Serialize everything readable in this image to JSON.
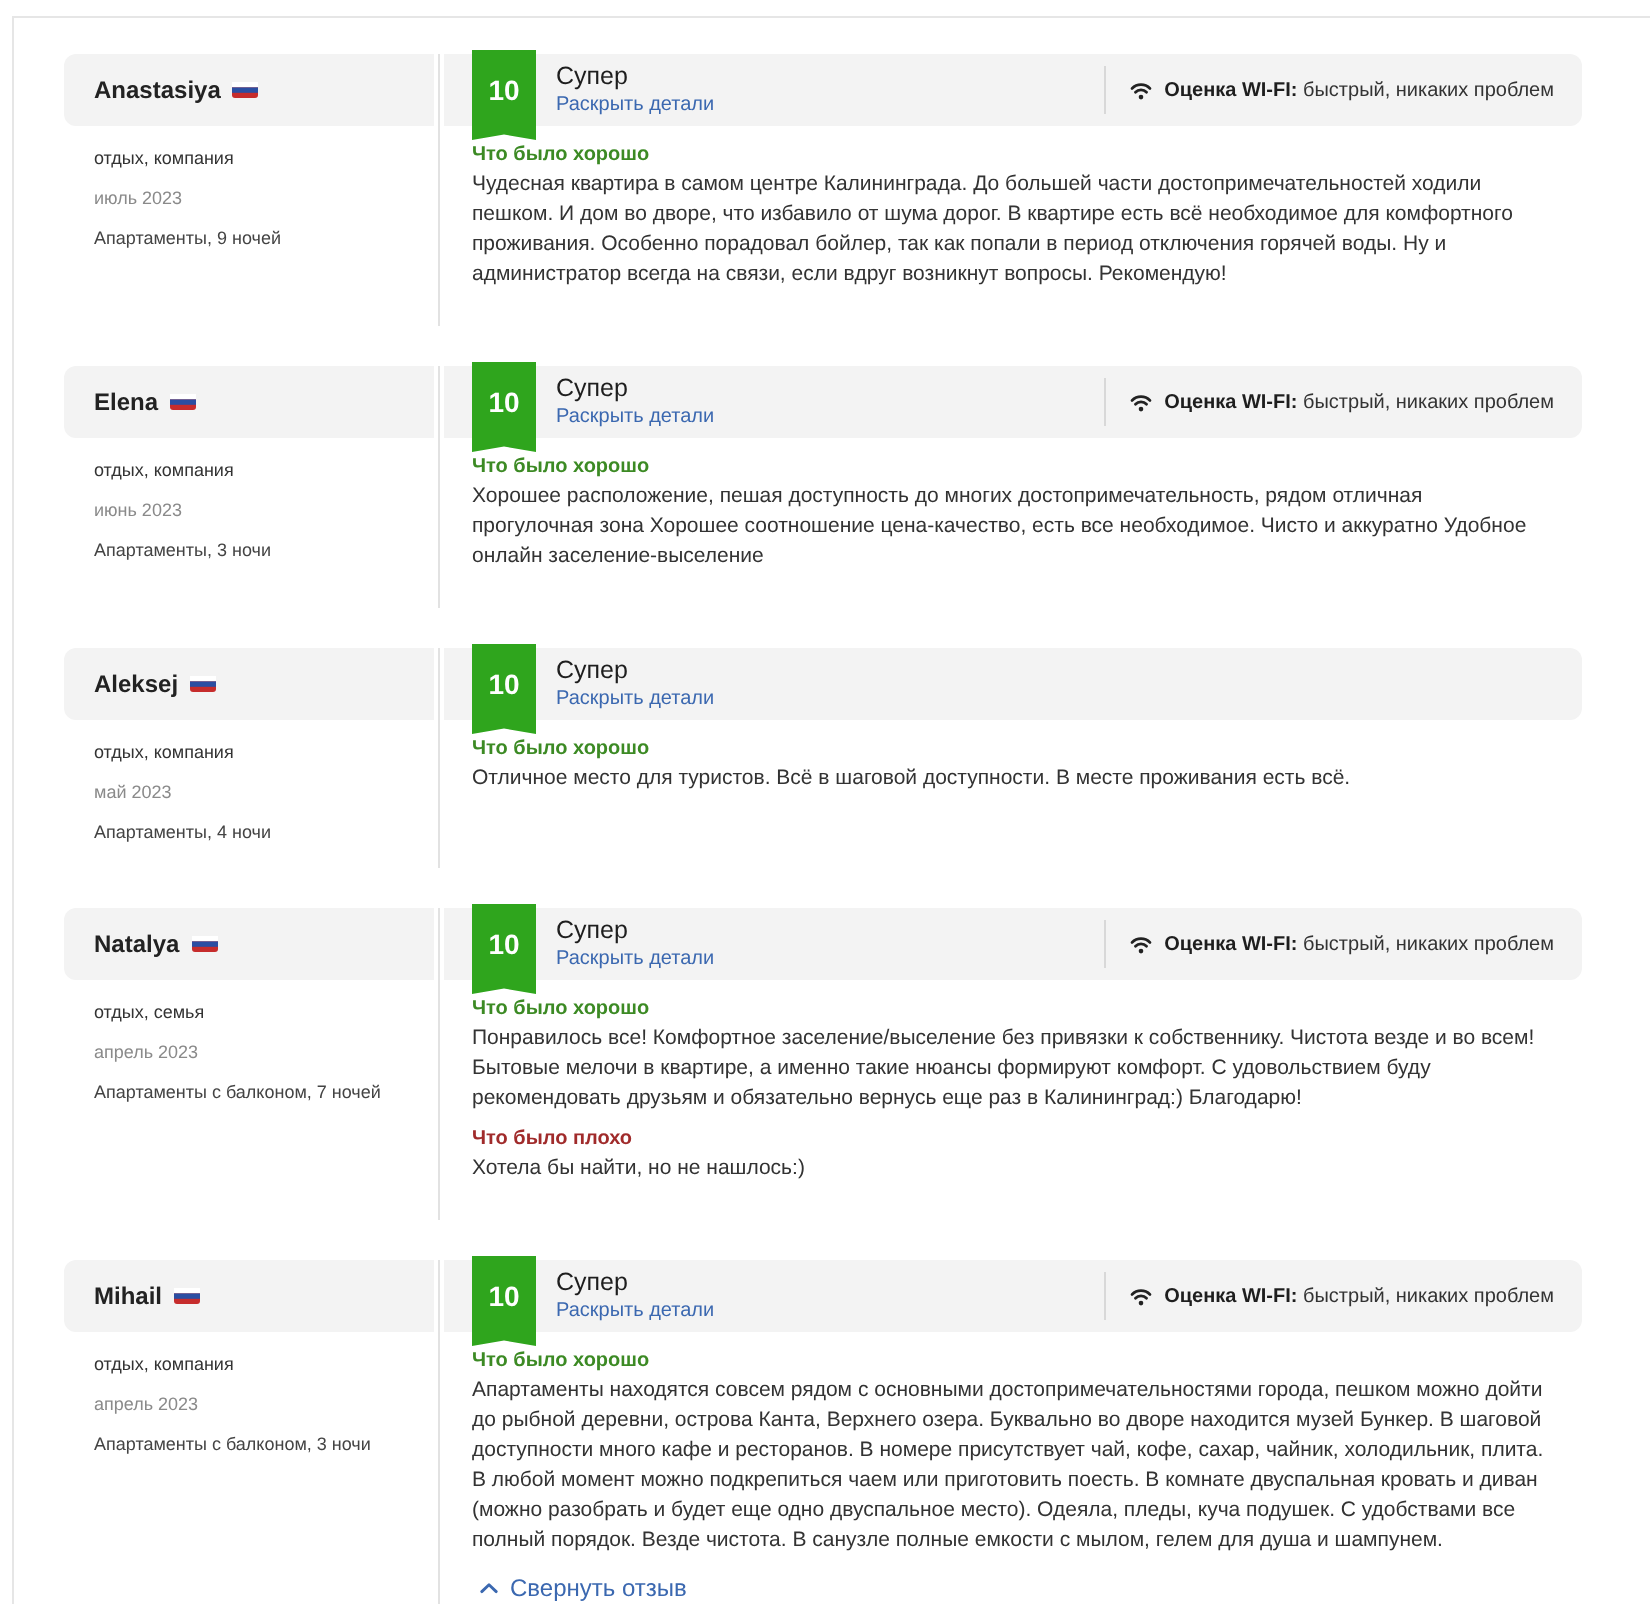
{
  "reviews": [
    {
      "name": "Anastasiya",
      "trip_type": "отдых, компания",
      "date": "июль 2023",
      "stay": "Апартаменты, 9 ночей",
      "score": "10",
      "verdict": "Супер",
      "details_link": "Раскрыть детали",
      "wifi": {
        "label": "Оценка WI-FI:",
        "value": "быстрый, никаких проблем"
      },
      "sections": [
        {
          "kind": "liked",
          "heading": "Что было хорошо",
          "text": "Чудесная квартира в самом центре Калининграда. До большей части достопримечательностей ходили пешком. И дом во дворе, что избавило от шума дорог. В квартире есть всё необходимое для комфортного проживания. Особенно порадовал бойлер, так как попали в период отключения горячей воды. Ну и администратор всегда на связи, если вдруг возникнут вопросы. Рекомендую!"
        }
      ]
    },
    {
      "name": "Elena",
      "trip_type": "отдых, компания",
      "date": "июнь 2023",
      "stay": "Апартаменты, 3 ночи",
      "score": "10",
      "verdict": "Супер",
      "details_link": "Раскрыть детали",
      "wifi": {
        "label": "Оценка WI-FI:",
        "value": "быстрый, никаких проблем"
      },
      "sections": [
        {
          "kind": "liked",
          "heading": "Что было хорошо",
          "text": "Хорошее расположение, пешая доступность до многих достопримечательность, рядом отличная прогулочная зона Хорошее соотношение цена-качество, есть все необходимое. Чисто и аккуратно Удобное онлайн заселение-выселение"
        }
      ]
    },
    {
      "name": "Aleksej",
      "trip_type": "отдых, компания",
      "date": "май 2023",
      "stay": "Апартаменты, 4 ночи",
      "score": "10",
      "verdict": "Супер",
      "details_link": "Раскрыть детали",
      "sections": [
        {
          "kind": "liked",
          "heading": "Что было хорошо",
          "text": "Отличное место для туристов. Всё в шаговой доступности. В месте проживания есть всё."
        }
      ]
    },
    {
      "name": "Natalya",
      "trip_type": "отдых, семья",
      "date": "апрель 2023",
      "stay": "Апартаменты с балконом, 7 ночей",
      "score": "10",
      "verdict": "Супер",
      "details_link": "Раскрыть детали",
      "wifi": {
        "label": "Оценка WI-FI:",
        "value": "быстрый, никаких проблем"
      },
      "sections": [
        {
          "kind": "liked",
          "heading": "Что было хорошо",
          "text": "Понравилось все! Комфортное заселение/выселение без привязки к собственнику. Чистота везде и во всем! Бытовые мелочи в квартире, а именно такие нюансы формируют комфорт. С удовольствием буду рекомендовать друзьям и обязательно вернусь еще раз в Калининград:) Благодарю!"
        },
        {
          "kind": "disliked",
          "heading": "Что было плохо",
          "text": "Хотела бы найти, но не нашлось:)"
        }
      ]
    },
    {
      "name": "Mihail",
      "trip_type": "отдых, компания",
      "date": "апрель 2023",
      "stay": "Апартаменты с балконом, 3 ночи",
      "score": "10",
      "verdict": "Супер",
      "details_link": "Раскрыть детали",
      "wifi": {
        "label": "Оценка WI-FI:",
        "value": "быстрый, никаких проблем"
      },
      "sections": [
        {
          "kind": "liked",
          "heading": "Что было хорошо",
          "text": "Апартаменты находятся совсем рядом с основными достопримечательностями города, пешком можно дойти до рыбной деревни, острова Канта, Верхнего озера. Буквально во дворе находится музей Бункер. В шаговой доступности много кафе и ресторанов. В номере присутствует чай, кофе, сахар, чайник, холодильник, плита. В любой момент можно подкрепиться чаем или приготовить поесть. В комнате двуспальная кровать и диван (можно разобрать и будет еще одно двуспальное место). Одеяла, пледы, куча подушек. С удобствами все полный порядок. Везде чистота. В санузле полные емкости с мылом, гелем для душа и шампунем."
        }
      ],
      "collapse_link": "Свернуть отзыв"
    }
  ]
}
